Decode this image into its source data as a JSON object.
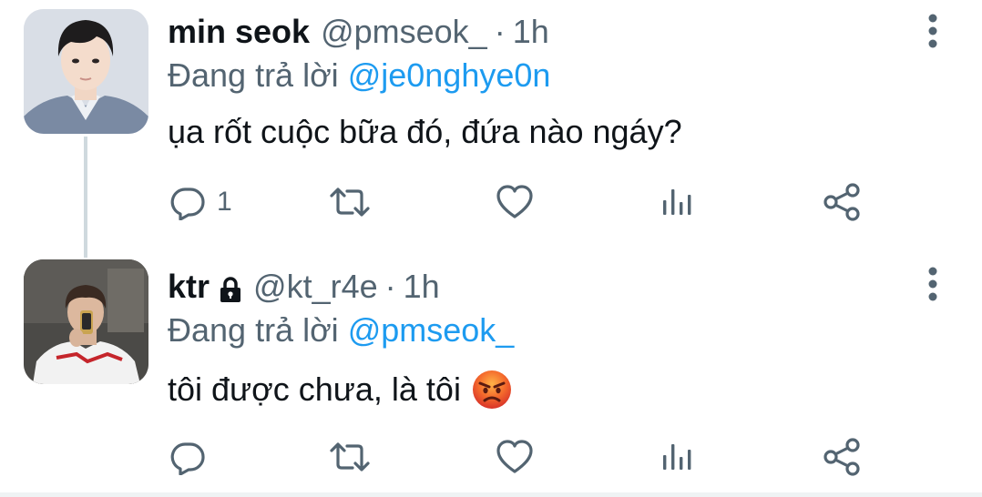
{
  "tweets": [
    {
      "display_name": "min seok",
      "handle": "@pmseok_",
      "separator": "·",
      "time": "1h",
      "reply_prefix": "Đang trả lời",
      "reply_to": "@je0nghye0n",
      "text": "ụa rốt cuộc bữa đó, đứa nào ngáy?",
      "reply_count": "1",
      "avatar_icon": "person-avatar"
    },
    {
      "display_name": "ktr",
      "handle": "@kt_r4e",
      "separator": "·",
      "time": "1h",
      "reply_prefix": "Đang trả lời",
      "reply_to": "@pmseok_",
      "text": "tôi được chưa, là tôi",
      "reply_count": "",
      "emoji": "angry-face",
      "protected": true,
      "avatar_icon": "person-avatar"
    }
  ],
  "colors": {
    "accent": "#1d9bf0",
    "text_primary": "#0f1419",
    "text_secondary": "#536471",
    "icon": "#536471",
    "thread_line": "#cfd9de"
  }
}
